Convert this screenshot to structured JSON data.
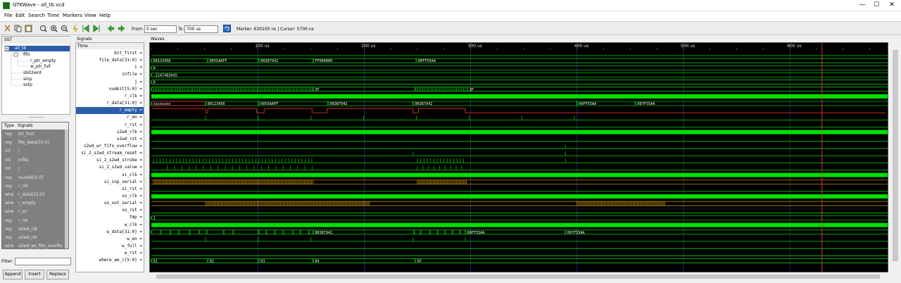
{
  "window": {
    "title": "GTKWave - all_tb.vcd",
    "minimize": "—",
    "maximize": "☐",
    "close": "✕"
  },
  "menu": [
    "File",
    "Edit",
    "Search",
    "Time",
    "Markers",
    "View",
    "Help"
  ],
  "toolbar": {
    "from_label": "From:",
    "from_value": "0 sec",
    "to_label": "To:",
    "to_value": "700 us",
    "marker_text": "Marker: 630100 ns  |  Cursor: 5700 ns"
  },
  "sst": {
    "header": "SST",
    "items": [
      "all_tb",
      "fifo",
      "r_ptr_empty",
      "w_ptr_full",
      "sbit2wrd",
      "sinp",
      "sotp"
    ]
  },
  "type_pane": {
    "header_type": "Type",
    "header_signals": "Signals",
    "rows": [
      {
        "t": "reg",
        "n": "bit_first"
      },
      {
        "t": "reg",
        "n": "file_data[31:0]"
      },
      {
        "t": "int",
        "n": "i"
      },
      {
        "t": "int",
        "n": "infile"
      },
      {
        "t": "int",
        "n": "j"
      },
      {
        "t": "reg",
        "n": "numbit[5:0]"
      },
      {
        "t": "reg",
        "n": "r_clk"
      },
      {
        "t": "wire",
        "n": "r_data[31:0]"
      },
      {
        "t": "wire",
        "n": "r_empty"
      },
      {
        "t": "wire",
        "n": "r_en"
      },
      {
        "t": "reg",
        "n": "r_rst"
      },
      {
        "t": "reg",
        "n": "s2wd_clk"
      },
      {
        "t": "reg",
        "n": "s2wd_rst"
      },
      {
        "t": "wire",
        "n": "s2wd_wr_fifo_overflo"
      }
    ]
  },
  "filter_label": "Filter:",
  "buttons": {
    "append": "Append",
    "insert": "Insert",
    "replace": "Replace"
  },
  "signals_header": "Signals",
  "time_label": "Time",
  "signals": [
    "bit_first =",
    "file_data[31:0] =",
    "i =",
    "infile =",
    "j =",
    "numbit[5:0] =",
    "r_clk =",
    "r_data[31:0] =",
    "r_empty =",
    "r_en =",
    "r_rst =",
    "s2wd_clk =",
    "s2wd_rst =",
    "s2wd_wr_fifo_overflow =",
    "si_2_s2wd_stream_reset =",
    "si_2_s2wd_strobe =",
    "si_2_s2wd_value =",
    "si_clk =",
    "si_inp_serial =",
    "si_rst =",
    "so_clk =",
    "so_out_serial =",
    "so_rst =",
    "tmp =",
    "w_clk =",
    "w_data[31:0] =",
    "w_en =",
    "w_full =",
    "w_rst =",
    "where_am_i[5:0] ="
  ],
  "waves_header": "Waves",
  "time_ticks": [
    "100 us",
    "200 us",
    "300 us",
    "400 us",
    "500 us",
    "600 us"
  ],
  "wave_labels": {
    "file_data": [
      "00123456",
      "0055AAFF",
      "00387942",
      "FF000000",
      "00FF55AA"
    ],
    "i": "0",
    "infile": "-2147483645",
    "j": "0",
    "numbit": [
      "3F",
      "3F"
    ],
    "r_data": [
      "xxxxxxxx",
      "00123456",
      "0055AAFF",
      "00387942",
      "00387942",
      "00FF55AA",
      "007F55AA"
    ],
    "tmp": "1",
    "w_data": [
      "00387942",
      "00FF55AA",
      "007F55AA"
    ],
    "where_am_i": [
      "01",
      "02",
      "03",
      "04",
      "05"
    ]
  },
  "colors": {
    "wave": "#00e000",
    "empty": "#e03030",
    "serial": "#e0a000",
    "marker": "#c04040",
    "grid": "#1a3a7a"
  }
}
